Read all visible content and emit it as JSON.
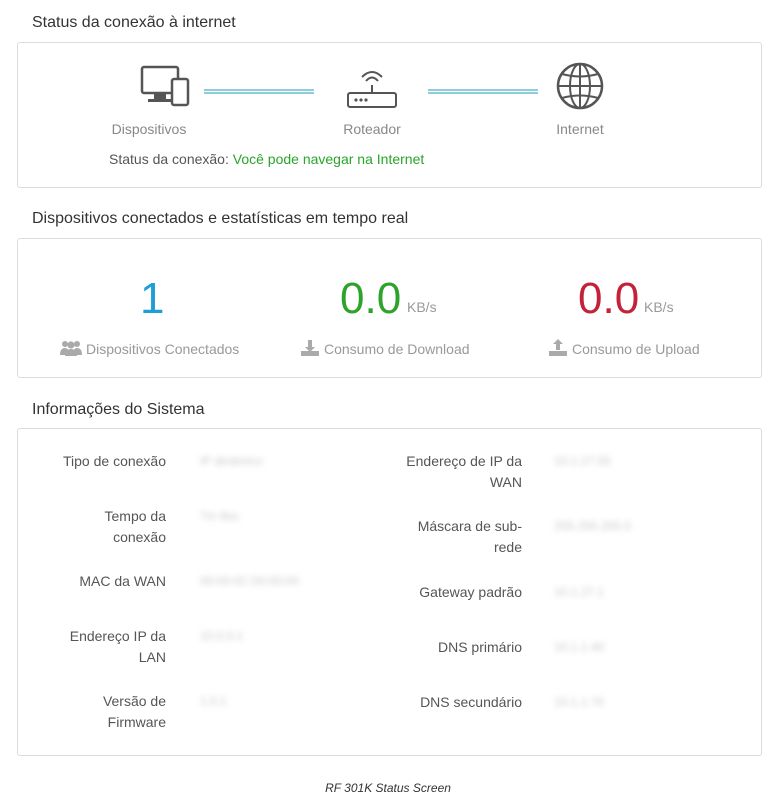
{
  "internet_status": {
    "title": "Status da conexão à internet",
    "devices_label": "Dispositivos",
    "router_label": "Roteador",
    "internet_label": "Internet",
    "status_prefix": "Status da conexão:",
    "status_value": "Você pode navegar na Internet",
    "line_color": "#8ccde0",
    "status_color": "#29a52b"
  },
  "realtime": {
    "title": "Dispositivos conectados e estatísticas em tempo real",
    "devices": {
      "value": "1",
      "label": "Dispositivos Conectados",
      "color": "#1b9fd6",
      "icon": "users-icon"
    },
    "download": {
      "value": "0.0",
      "unit": "KB/s",
      "label": "Consumo de Download",
      "color": "#2da32a",
      "icon": "download-icon"
    },
    "upload": {
      "value": "0.0",
      "unit": "KB/s",
      "label": "Consumo de Upload",
      "color": "#c4223a",
      "icon": "upload-icon"
    }
  },
  "system": {
    "title": "Informações do Sistema",
    "left": [
      {
        "label": "Tipo de conexão",
        "value": "IP dinâmico"
      },
      {
        "label": "Tempo da conexão",
        "value": "7m 8ss"
      },
      {
        "label": "MAC da WAN",
        "value": "00:00:0C:00:00:00"
      },
      {
        "label": "Endereço IP da LAN",
        "value": "10.0.0.1"
      },
      {
        "label": "Versão de Firmware",
        "value": "1.0.1"
      }
    ],
    "right": [
      {
        "label": "Endereço de IP da WAN",
        "value": "10.1.27.55"
      },
      {
        "label": "Máscara de sub-rede",
        "value": "255.255.255.0"
      },
      {
        "label": "Gateway padrão",
        "value": "10.1.27.1"
      },
      {
        "label": "DNS primário",
        "value": "10.1.1.40"
      },
      {
        "label": "DNS secundário",
        "value": "10.1.1.70"
      }
    ]
  },
  "caption": "RF 301K Status Screen"
}
